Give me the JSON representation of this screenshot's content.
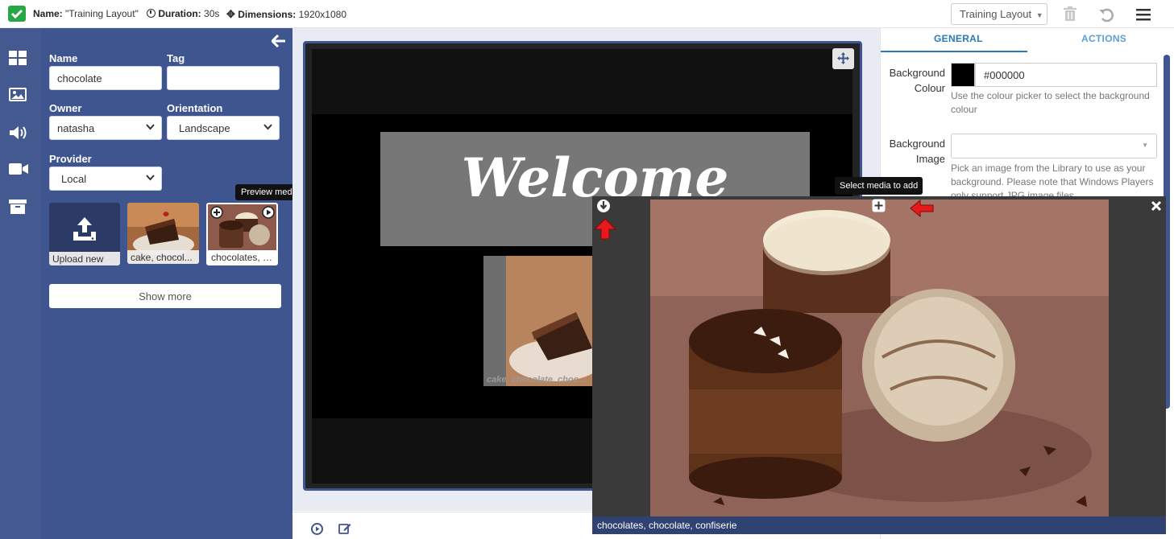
{
  "topbar": {
    "name_label": "Name:",
    "name_value": "\"Training Layout\"",
    "duration_label": "Duration:",
    "duration_value": "30s",
    "dimensions_label": "Dimensions:",
    "dimensions_value": "1920x1080",
    "layout_selector": "Training Layout",
    "icons": [
      "check-icon",
      "clock-icon",
      "move-icon",
      "trash-icon",
      "undo-icon",
      "menu-icon"
    ]
  },
  "rail": {
    "icons": [
      "layouts-grid-icon",
      "image-icon",
      "audio-icon",
      "video-icon",
      "archive-icon"
    ]
  },
  "panel": {
    "name_label": "Name",
    "name_value": "chocolate",
    "tag_label": "Tag",
    "tag_value": "",
    "owner_label": "Owner",
    "owner_value": "natasha",
    "orientation_label": "Orientation",
    "orientation_value": "Landscape",
    "provider_label": "Provider",
    "provider_value": "Local",
    "tiles": [
      {
        "caption": "Upload new"
      },
      {
        "caption": "cake, chocol..."
      },
      {
        "caption": "chocolates, c..."
      }
    ],
    "show_more": "Show more",
    "tooltip_preview": "Preview media"
  },
  "canvas": {
    "welcome_text": "Welcome",
    "cake_caption": "cake, chocolate, choc..."
  },
  "properties": {
    "tabs": [
      "GENERAL",
      "ACTIONS"
    ],
    "background_colour_label_1": "Background",
    "background_colour_label_2": "Colour",
    "background_colour_value": "#000000",
    "background_colour_help_1": "Use the colour picker to select the background",
    "background_colour_help_2": "colour",
    "background_image_label_1": "Background",
    "background_image_label_2": "Image",
    "background_image_help_1": "Pick an image from the Library to use as your",
    "background_image_help_2": "background. Please note that Windows Players",
    "background_image_help_3": "only support JPG image files."
  },
  "overlay": {
    "tooltip_select": "Select media to add",
    "caption": "chocolates, chocolate, confiserie"
  },
  "colors": {
    "rail": "#44598f",
    "panel": "#3e5590",
    "accent": "#2a7ab8",
    "success": "#28a745",
    "annotation_red": "#e8191b"
  }
}
